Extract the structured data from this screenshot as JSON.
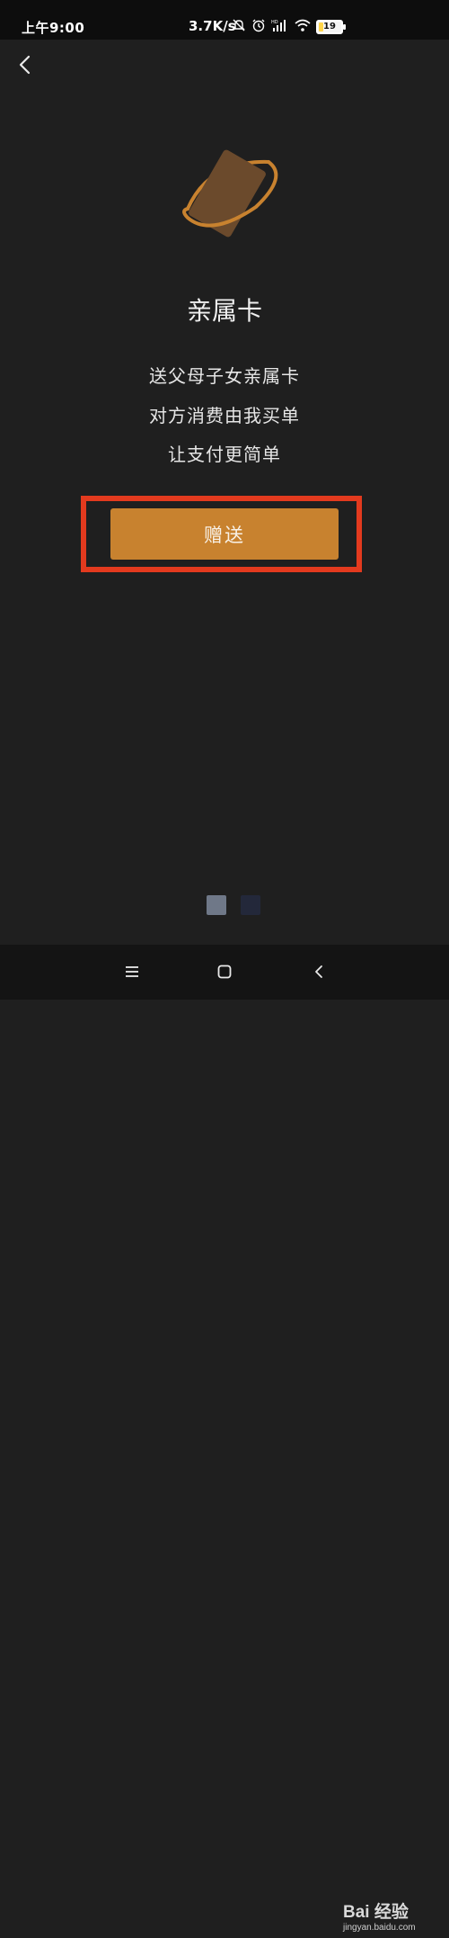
{
  "status_bar": {
    "time": "上午9:00",
    "network_speed": "3.7K/s",
    "battery_level": "19",
    "icons": [
      "mute-bell-icon",
      "alarm-icon",
      "hd-signal-icon",
      "wifi-icon",
      "battery-icon"
    ]
  },
  "nav": {
    "back_icon": "chevron-left-icon"
  },
  "card": {
    "logo": "family-card-logo",
    "title": "亲属卡",
    "description": [
      "送父母子女亲属卡",
      "对方消费由我买单",
      "让支付更简单"
    ]
  },
  "actions": {
    "gift_button_label": "赠送"
  },
  "pager": {
    "total": 2,
    "active": 0
  },
  "system_nav": {
    "menu_icon": "menu-icon",
    "home_icon": "home-icon",
    "back_icon": "back-icon"
  },
  "watermark": {
    "main": "Bai 经验",
    "sub": "jingyan.baidu.com"
  },
  "colors": {
    "background": "#1f1f1f",
    "accent": "#c8822f",
    "highlight": "#e33a1e"
  }
}
